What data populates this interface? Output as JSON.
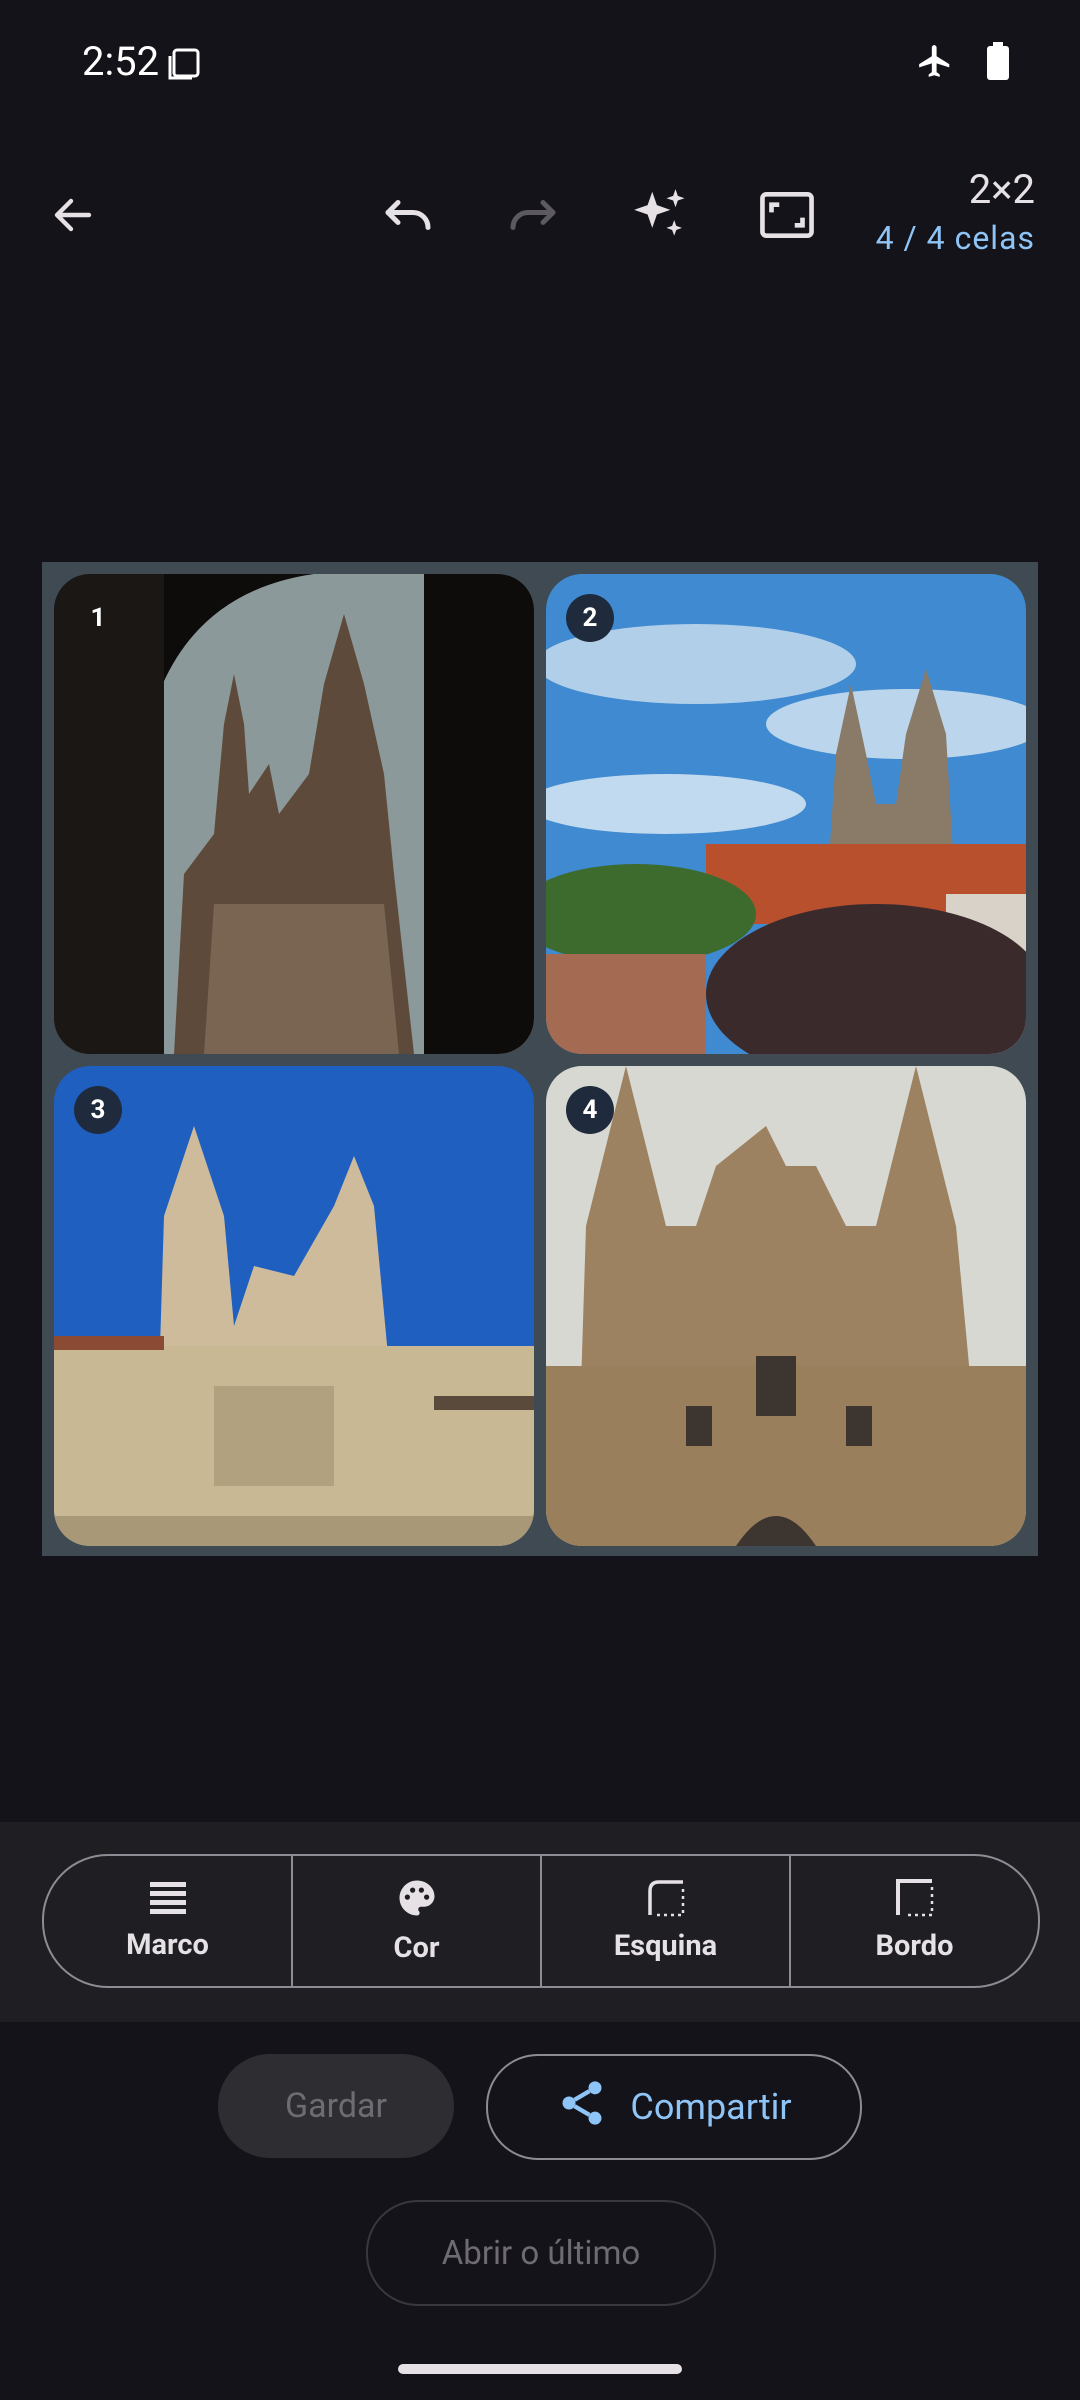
{
  "status": {
    "time": "2:52"
  },
  "toolbar": {
    "icons": [
      "back-arrow-icon",
      "undo-icon",
      "redo-icon",
      "sparkle-icon",
      "aspect-ratio-icon"
    ],
    "grid_size": "2×2",
    "cells_label": "4 / 4 celas"
  },
  "collage": {
    "cells": [
      {
        "number": "1"
      },
      {
        "number": "2"
      },
      {
        "number": "3"
      },
      {
        "number": "4"
      }
    ]
  },
  "tools": [
    {
      "label": "Marco",
      "icon": "frame-lines-icon"
    },
    {
      "label": "Cor",
      "icon": "palette-icon"
    },
    {
      "label": "Esquina",
      "icon": "corner-icon"
    },
    {
      "label": "Bordo",
      "icon": "border-icon"
    }
  ],
  "actions": {
    "save_label": "Gardar",
    "share_label": "Compartir",
    "open_last_label": "Abrir o último"
  },
  "colors": {
    "accent": "#8fc4f7",
    "background": "#15131a",
    "frame": "#3f4a52"
  }
}
